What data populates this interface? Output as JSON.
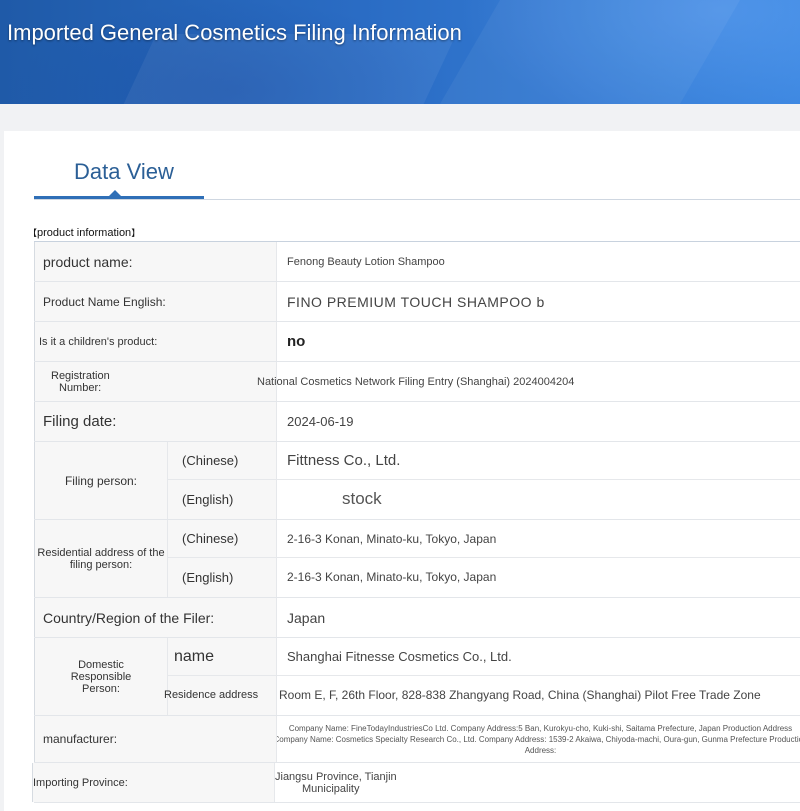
{
  "header": {
    "title": "Imported General Cosmetics Filing Information"
  },
  "tabs": {
    "active_label": "Data View"
  },
  "section": {
    "label": "product information"
  },
  "rows": {
    "product_name": {
      "label": "product name:",
      "value": "Fenong Beauty Lotion Shampoo"
    },
    "product_name_en": {
      "label": "Product Name English:",
      "value": "FINO PREMIUM TOUCH SHAMPOO b"
    },
    "children": {
      "label": "Is it a children's product:",
      "value": "no"
    },
    "registration": {
      "label_line1": "Registration",
      "label_line2": "Number:",
      "value": "National Cosmetics Network Filing Entry (Shanghai) 2024004204"
    },
    "filing_date": {
      "label": "Filing date:",
      "value": "2024-06-19"
    },
    "filing_person": {
      "label": "Filing person:",
      "chinese_label": "(Chinese)",
      "chinese_value": "Fittness Co., Ltd.",
      "english_label": "(English)",
      "english_value": "stock"
    },
    "residential": {
      "label_line1": "Residential address of the",
      "label_line2": "filing person:",
      "chinese_label": "(Chinese)",
      "chinese_value": "2-16-3 Konan, Minato-ku, Tokyo, Japan",
      "english_label": "(English)",
      "english_value": "2-16-3 Konan, Minato-ku, Tokyo, Japan"
    },
    "country": {
      "label": "Country/Region of the Filer:",
      "value": "Japan"
    },
    "domestic": {
      "label_line1": "Domestic",
      "label_line2": "Responsible",
      "label_line3": "Person:",
      "name_label": "name",
      "name_value": "Shanghai Fitnesse Cosmetics Co., Ltd.",
      "address_label": "Residence address",
      "address_value": "Room E, F, 26th Floor, 828-838 Zhangyang Road, China (Shanghai) Pilot Free Trade Zone"
    },
    "manufacturer": {
      "label": "manufacturer:",
      "line1": "Company Name: FineTodayIndustriesCo Ltd. Company Address:5 Ban, Kurokyu-cho, Kuki-shi, Saitama Prefecture, Japan Production Address",
      "line2": "Company Name: Cosmetics Specialty Research Co., Ltd. Company Address: 1539-2 Akaiwa, Chiyoda-machi, Oura-gun, Gunma Prefecture Production",
      "line3": "Address:"
    },
    "importing": {
      "label": "Importing Province:",
      "value_line1": "Jiangsu Province, Tianjin",
      "value_line2": "Municipality"
    }
  }
}
